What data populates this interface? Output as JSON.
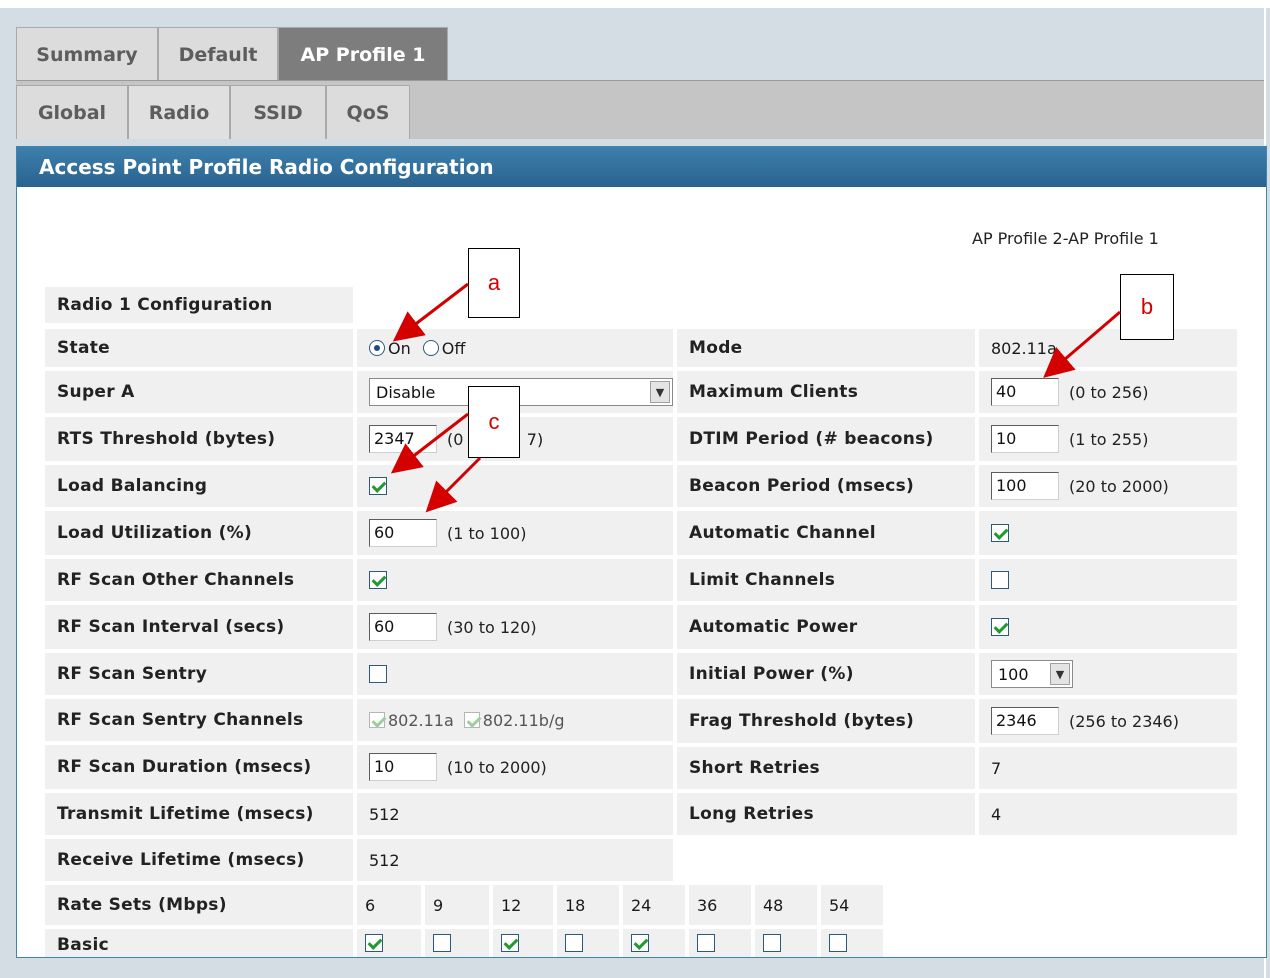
{
  "tabs_top": [
    "Summary",
    "Default",
    "AP Profile 1"
  ],
  "tabs_sub": [
    "Global",
    "Radio",
    "SSID",
    "QoS"
  ],
  "panel": {
    "title": "Access Point Profile Radio Configuration",
    "profile_path": "AP Profile 2-AP Profile 1",
    "section_title": "Radio 1 Configuration"
  },
  "left": {
    "state": {
      "label": "State",
      "on": "On",
      "off": "Off",
      "selected": "On"
    },
    "super_a": {
      "label": "Super A",
      "value": "Disable"
    },
    "rts": {
      "label": "RTS Threshold (bytes)",
      "value": "2347",
      "hint": "(0 t",
      "hint_tail": "7)"
    },
    "load_balancing": {
      "label": "Load Balancing",
      "checked": true
    },
    "load_utilization": {
      "label": "Load Utilization (%)",
      "value": "60",
      "hint": "(1 to 100)"
    },
    "rf_scan_other": {
      "label": "RF Scan Other Channels",
      "checked": true
    },
    "rf_scan_interval": {
      "label": "RF Scan Interval (secs)",
      "value": "60",
      "hint": "(30 to 120)"
    },
    "rf_scan_sentry": {
      "label": "RF Scan Sentry",
      "checked": false
    },
    "rf_scan_sentry_channels": {
      "label": "RF Scan Sentry Channels",
      "opt1": "802.11a",
      "opt2": "802.11b/g"
    },
    "rf_scan_duration": {
      "label": "RF Scan Duration (msecs)",
      "value": "10",
      "hint": "(10 to 2000)"
    },
    "transmit_lifetime": {
      "label": "Transmit Lifetime (msecs)",
      "value": "512"
    },
    "receive_lifetime": {
      "label": "Receive Lifetime (msecs)",
      "value": "512"
    }
  },
  "right": {
    "mode": {
      "label": "Mode",
      "value": "802.11a"
    },
    "max_clients": {
      "label": "Maximum Clients",
      "value": "40",
      "hint": "(0 to 256)"
    },
    "dtim": {
      "label": "DTIM Period (# beacons)",
      "value": "10",
      "hint": "(1 to 255)"
    },
    "beacon": {
      "label": "Beacon Period (msecs)",
      "value": "100",
      "hint": "(20 to 2000)"
    },
    "auto_channel": {
      "label": "Automatic Channel",
      "checked": true
    },
    "limit_channels": {
      "label": "Limit Channels",
      "checked": false
    },
    "auto_power": {
      "label": "Automatic Power",
      "checked": true
    },
    "initial_power": {
      "label": "Initial Power (%)",
      "value": "100"
    },
    "frag": {
      "label": "Frag Threshold (bytes)",
      "value": "2346",
      "hint": "(256 to 2346)"
    },
    "short_retries": {
      "label": "Short Retries",
      "value": "7"
    },
    "long_retries": {
      "label": "Long Retries",
      "value": "4"
    }
  },
  "rates": {
    "label": "Rate Sets (Mbps)",
    "basic_label": "Basic",
    "values": [
      "6",
      "9",
      "12",
      "18",
      "24",
      "36",
      "48",
      "54"
    ],
    "basic": [
      true,
      false,
      true,
      false,
      true,
      false,
      false,
      false
    ]
  },
  "callouts": {
    "a": "a",
    "b": "b",
    "c": "c"
  },
  "colors": {
    "header": "#2f6f9c",
    "annotation": "#d40000",
    "check": "#1e9a2e"
  }
}
